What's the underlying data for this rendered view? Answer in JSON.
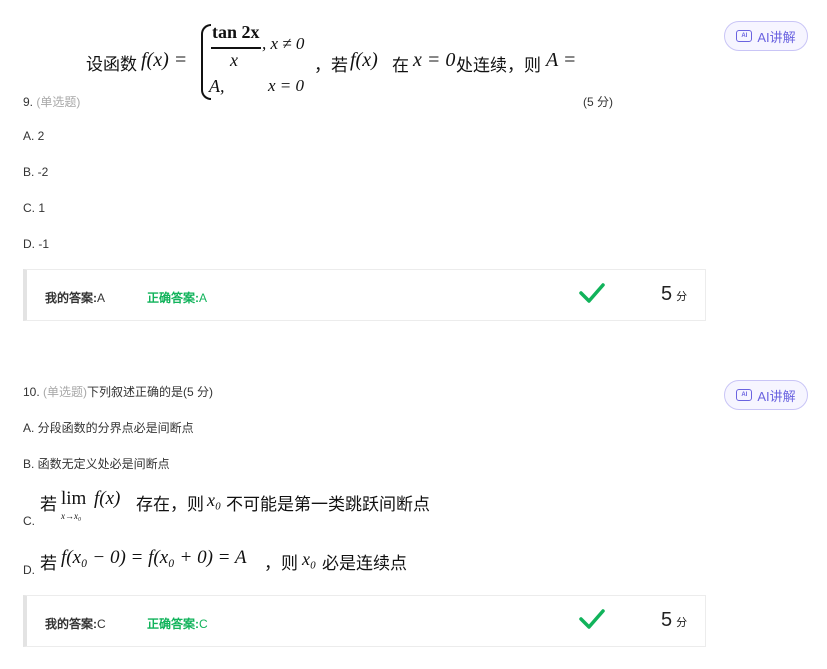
{
  "q9": {
    "formula": {
      "prefix": "设函数",
      "fx": "f(x) =",
      "num": "tan 2x",
      "den": "x",
      "cond1": ", x ≠ 0",
      "case2": "A,",
      "cond2": "x = 0",
      "suffix1": "，若",
      "fx2": "f(x)",
      "suffix2": "在",
      "xeq": "x = 0",
      "suffix3": "处连续，则",
      "aeq": "A ="
    },
    "number": "9.",
    "type": "(单选题)",
    "points": "(5 分)",
    "options": [
      "A. 2",
      "B. -2",
      "C. 1",
      "D. -1"
    ],
    "ai_label": "AI讲解",
    "answer": {
      "my_label": "我的答案:",
      "my_value": "A",
      "correct_label": "正确答案:",
      "correct_value": "A",
      "score": "5",
      "score_unit": "分"
    }
  },
  "q10": {
    "number": "10.",
    "type": "(单选题)",
    "stem": "下列叙述正确的是(5 分)",
    "options": [
      "A. 分段函数的分界点必是间断点",
      "B. 函数无定义处必是间断点"
    ],
    "optC": {
      "label": "C.",
      "pre": "若",
      "lim": "lim",
      "sub": "x→x₀",
      "fx": "f(x)",
      "mid": "存在，则",
      "x0": "x₀",
      "post": "不可能是第一类跳跃间断点"
    },
    "optD": {
      "label": "D.",
      "pre": "若",
      "expr": "f(x₀ − 0) = f(x₀ + 0) = A",
      "mid": "，则",
      "x0": "x₀",
      "post": "必是连续点"
    },
    "ai_label": "AI讲解",
    "answer": {
      "my_label": "我的答案:",
      "my_value": "C",
      "correct_label": "正确答案:",
      "correct_value": "C",
      "score": "5",
      "score_unit": "分"
    }
  },
  "colors": {
    "correct": "#11b35b",
    "ai": "#6a63e0",
    "type": "#a8a8a8"
  },
  "icons": {
    "ai": "ai-chip-icon",
    "check": "checkmark-icon"
  }
}
